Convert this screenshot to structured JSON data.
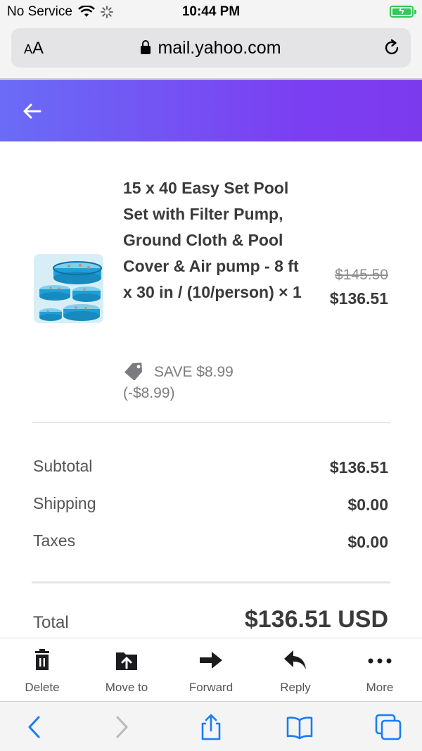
{
  "status_bar": {
    "carrier": "No Service",
    "time": "10:44 PM"
  },
  "browser": {
    "text_size_small": "A",
    "text_size_large": "A",
    "url": "mail.yahoo.com"
  },
  "order": {
    "product_title": "15 x 40 Easy Set Pool Set with Filter Pump, Ground Cloth & Pool Cover & Air pump - 8 ft x 30 in / (10/person) × 1",
    "original_price": "$145.50",
    "price": "$136.51",
    "savings": "SAVE $8.99 (-$8.99)",
    "summary": [
      {
        "label": "Subtotal",
        "value": "$136.51"
      },
      {
        "label": "Shipping",
        "value": "$0.00"
      },
      {
        "label": "Taxes",
        "value": "$0.00"
      }
    ],
    "total_label": "Total",
    "total_value": "$136.51 USD"
  },
  "actions": [
    {
      "label": "Delete",
      "icon": "trash-icon"
    },
    {
      "label": "Move to",
      "icon": "move-folder-icon"
    },
    {
      "label": "Forward",
      "icon": "forward-arrow-icon"
    },
    {
      "label": "Reply",
      "icon": "reply-arrow-icon"
    },
    {
      "label": "More",
      "icon": "more-dots-icon"
    }
  ],
  "colors": {
    "header_gradient_start": "#6a6cf6",
    "header_gradient_end": "#7c3aed",
    "safari_accent": "#1a7cf5",
    "battery": "#34c759"
  }
}
